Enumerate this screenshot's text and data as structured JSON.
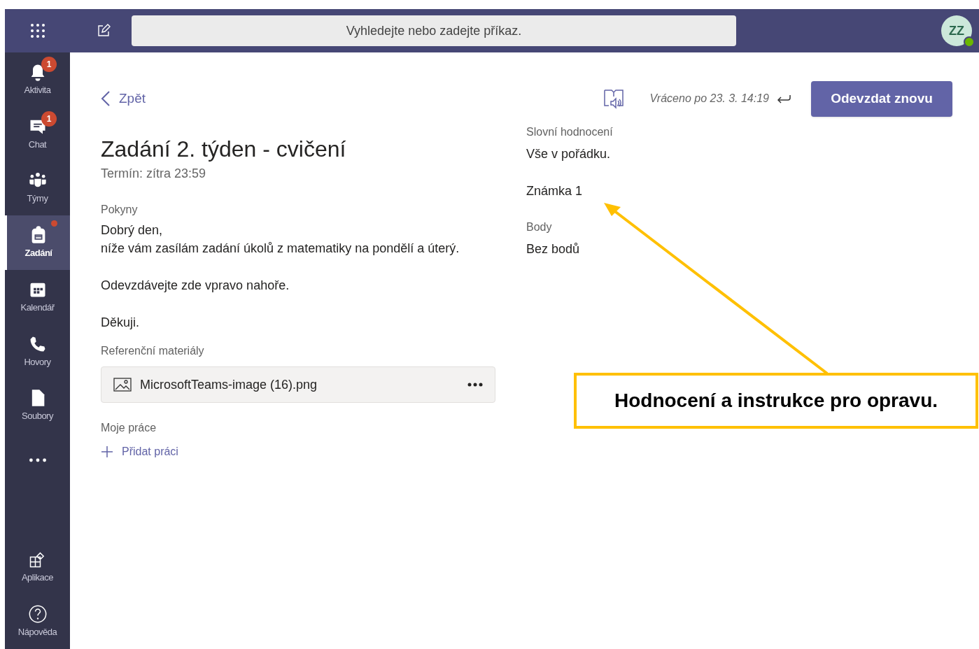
{
  "top_bar": {
    "search": {
      "placeholder": "Vyhledejte nebo zadejte příkaz."
    },
    "avatar": {
      "initials": "ZZ",
      "online": true
    }
  },
  "sidebar": {
    "items": [
      {
        "kind": "bell",
        "label": "Aktivita",
        "badge": "1",
        "dot": false,
        "selected": false
      },
      {
        "kind": "chat",
        "label": "Chat",
        "badge": "1",
        "dot": false,
        "selected": false
      },
      {
        "kind": "teams",
        "label": "Týmy",
        "dot": false,
        "selected": false
      },
      {
        "kind": "backpack",
        "label": "Zadání",
        "dot": true,
        "selected": true
      },
      {
        "kind": "calendar",
        "label": "Kalendář",
        "dot": false,
        "selected": false
      },
      {
        "kind": "phone",
        "label": "Hovory",
        "dot": false,
        "selected": false
      },
      {
        "kind": "file",
        "label": "Soubory",
        "dot": false,
        "selected": false
      },
      {
        "kind": "more",
        "dot": false,
        "selected": false
      }
    ],
    "bottom_items": [
      {
        "kind": "apps",
        "label": "Aplikace",
        "selected": false
      },
      {
        "kind": "help",
        "label": "Nápověda",
        "selected": false
      }
    ]
  },
  "header": {
    "back": "Zpět",
    "status": "Vráceno po 23. 3. 14:19",
    "button": "Odevzdat znovu"
  },
  "assignment": {
    "title": "Zadání 2. týden - cvičení",
    "due": "Termín: zítra 23:59",
    "instructions_label": "Pokyny",
    "instructions": [
      [
        "Dobrý den,",
        "níže vám zasílám zadání úkolů z matematiky na pondělí a úterý."
      ],
      [
        "Odevzdávejte zde vpravo nahoře."
      ],
      [
        "Děkuji."
      ]
    ],
    "materials_label": "Referenční materiály",
    "materials": [
      {
        "name": "MicrosoftTeams-image (16).png"
      }
    ],
    "work_label": "Moje práce",
    "add_work": "Přidat práci"
  },
  "feedback": {
    "fields": [
      {
        "label": "Slovní hodnocení",
        "value": "Vše v pořádku."
      },
      {
        "value": "Známka 1"
      },
      {
        "label": "Body",
        "value": "Bez bodů"
      }
    ]
  },
  "annotation": {
    "text": "Hodnocení a instrukce pro opravu."
  }
}
